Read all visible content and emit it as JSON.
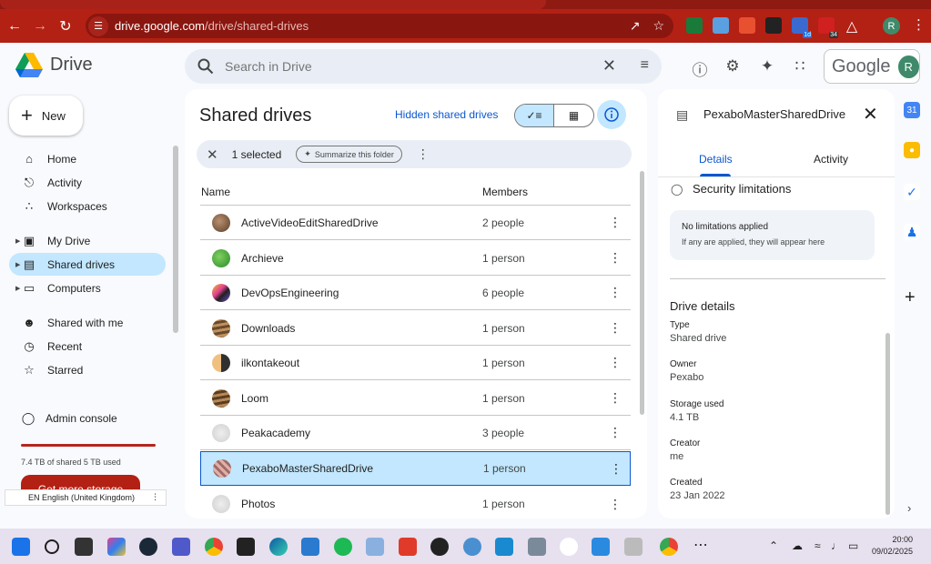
{
  "browser": {
    "url_host": "drive.google.com",
    "url_path": "/drive/shared-drives",
    "profile_initial": "R",
    "ext_badges": [
      "1d",
      "34"
    ]
  },
  "app": {
    "name": "Drive",
    "search_placeholder": "Search in Drive",
    "google_label": "Google",
    "avatar_initial": "R"
  },
  "sidebar": {
    "new_label": "New",
    "items": [
      {
        "label": "Home",
        "icon": "home-icon"
      },
      {
        "label": "Activity",
        "icon": "bell-icon"
      },
      {
        "label": "Workspaces",
        "icon": "workspaces-icon"
      },
      {
        "label": "My Drive",
        "icon": "my-drive-icon"
      },
      {
        "label": "Shared drives",
        "icon": "shared-drives-icon"
      },
      {
        "label": "Computers",
        "icon": "computer-icon"
      },
      {
        "label": "Shared with me",
        "icon": "people-icon"
      },
      {
        "label": "Recent",
        "icon": "clock-icon"
      },
      {
        "label": "Starred",
        "icon": "star-icon"
      },
      {
        "label": "Admin console",
        "icon": "admin-icon"
      }
    ],
    "storage_text": "7.4 TB of shared 5 TB used",
    "storage_fraction": 1.0,
    "get_storage_label": "Get more storage",
    "language_tip": "EN English (United Kingdom)"
  },
  "main": {
    "title": "Shared drives",
    "hidden_link": "Hidden shared drives",
    "selection_count": "1 selected",
    "summarize_label": "Summarize this folder",
    "columns": {
      "name": "Name",
      "members": "Members"
    },
    "rows": [
      {
        "name": "ActiveVideoEditSharedDrive",
        "members": "2 people",
        "color": "#8a6a4a"
      },
      {
        "name": "Archieve",
        "members": "1 person",
        "color": "#3fae3a"
      },
      {
        "name": "DevOpsEngineering",
        "members": "6 people",
        "color": "#c0387a"
      },
      {
        "name": "Downloads",
        "members": "1 person",
        "color": "#9a7440"
      },
      {
        "name": "ilkontakeout",
        "members": "1 person",
        "color": "#d9a060"
      },
      {
        "name": "Loom",
        "members": "1 person",
        "color": "#8c6640"
      },
      {
        "name": "Peakacademy",
        "members": "3 people",
        "color": "#d7d7d7"
      },
      {
        "name": "PexaboMasterSharedDrive",
        "members": "1 person",
        "color": "#c98f8a"
      },
      {
        "name": "Photos",
        "members": "1 person",
        "color": "#d7d7d7"
      }
    ],
    "selected_index": 7
  },
  "details": {
    "title": "PexaboMasterSharedDrive",
    "tabs": [
      "Details",
      "Activity"
    ],
    "security_title": "Security limitations",
    "limits_title": "No limitations applied",
    "limits_sub": "If any are applied, they will appear here",
    "drive_details_title": "Drive details",
    "fields": [
      {
        "key": "Type",
        "value": "Shared drive"
      },
      {
        "key": "Owner",
        "value": "Pexabo"
      },
      {
        "key": "Storage used",
        "value": "4.1 TB"
      },
      {
        "key": "Creator",
        "value": "me"
      },
      {
        "key": "Created",
        "value": "23 Jan 2022"
      }
    ]
  },
  "taskbar": {
    "time": "20:00",
    "date": "09/02/2025"
  },
  "colors": {
    "accent": "#0b57d0",
    "selected_bg": "#c2e7ff",
    "browser_red": "#b32114"
  }
}
